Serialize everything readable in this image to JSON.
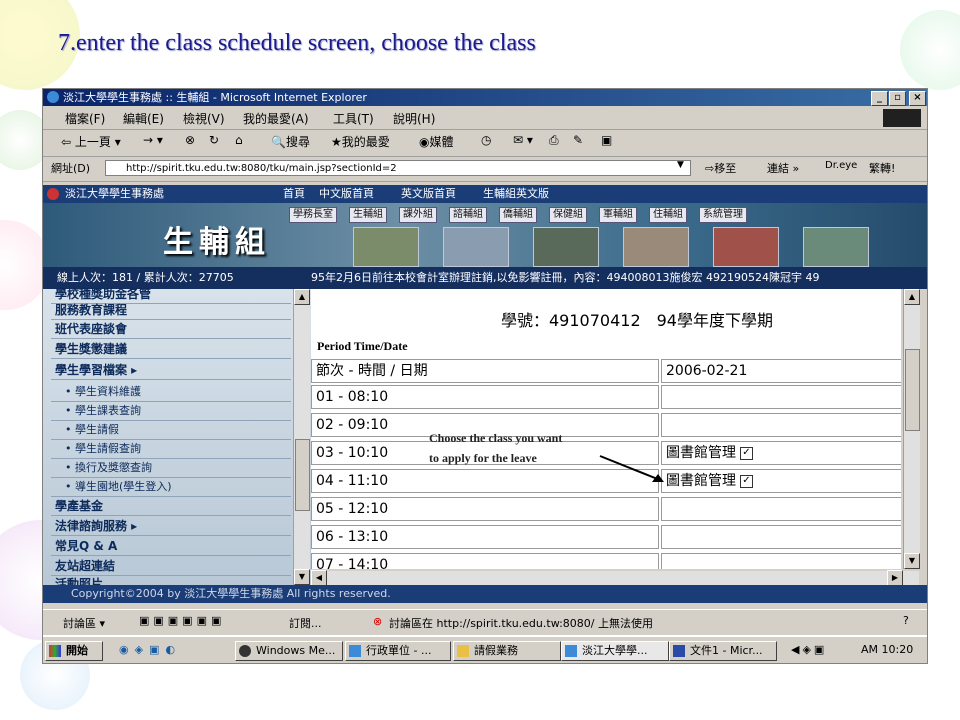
{
  "slide": {
    "title": "7.enter the class schedule screen, choose the class"
  },
  "window": {
    "title": "淡江大學學生事務處 :: 生輔組 - Microsoft Internet Explorer",
    "menu": [
      "檔案(F)",
      "編輯(E)",
      "檢視(V)",
      "我的最愛(A)",
      "工具(T)",
      "說明(H)"
    ],
    "toolbar": {
      "back": "上一頁",
      "search": "搜尋",
      "favorites": "我的最愛",
      "media": "媒體"
    },
    "address": {
      "label": "網址(D)",
      "url": "http://spirit.tku.edu.tw:8080/tku/main.jsp?sectionId=2",
      "go": "移至",
      "links": "連結",
      "dreye": "Dr.eye",
      "convert": "繁轉!"
    }
  },
  "site": {
    "header_title": "淡江大學學生事務處",
    "nav": [
      "首頁",
      "中文版首頁",
      "英文版首頁",
      "生輔組英文版"
    ],
    "logo": "生輔組",
    "tabs": [
      "學務長室",
      "生輔組",
      "課外組",
      "諮輔組",
      "僑輔組",
      "保健組",
      "軍輔組",
      "住輔組",
      "系統管理"
    ],
    "online": "線上人次：181 / 累計人次：27705",
    "marquee": "95年2月6日前往本校會計室辦理註銷,以免影響註冊，內容：494008013施俊宏 492190524陳冠宇 49",
    "sidebar": [
      {
        "label": "學校種獎助金各管",
        "type": "main"
      },
      {
        "label": "服務教育課程",
        "type": "main"
      },
      {
        "label": "班代表座談會",
        "type": "main"
      },
      {
        "label": "學生獎懲建議",
        "type": "main"
      },
      {
        "label": "學生學習檔案 ▸",
        "type": "main"
      },
      {
        "label": "學生資料維護",
        "type": "sub"
      },
      {
        "label": "學生課表查詢",
        "type": "sub"
      },
      {
        "label": "學生請假",
        "type": "sub"
      },
      {
        "label": "學生請假查詢",
        "type": "sub"
      },
      {
        "label": "換行及獎懲查詢",
        "type": "sub"
      },
      {
        "label": "導生園地(學生登入)",
        "type": "sub"
      },
      {
        "label": "學產基金",
        "type": "main"
      },
      {
        "label": "法律諮詢服務 ▸",
        "type": "main"
      },
      {
        "label": "常見Q & A",
        "type": "main"
      },
      {
        "label": "友站超連結",
        "type": "main"
      },
      {
        "label": "活動照片",
        "type": "main"
      }
    ],
    "copyright": "Copyright©2004 by 淡江大學學生事務處 All rights reserved."
  },
  "schedule": {
    "heading": "學號：491070412　94學年度下學期",
    "period_label": "Period Time/Date",
    "col1_header": "節次 - 時間 / 日期",
    "col2_header": "2006-02-21",
    "rows": [
      {
        "period": "01 - 08:10",
        "course": ""
      },
      {
        "period": "02 - 09:10",
        "course": ""
      },
      {
        "period": "03 - 10:10",
        "course": "圖書館管理",
        "checked": true
      },
      {
        "period": "04 - 11:10",
        "course": "圖書館管理",
        "checked": true
      },
      {
        "period": "05 - 12:10",
        "course": ""
      },
      {
        "period": "06 - 13:10",
        "course": ""
      },
      {
        "period": "07 - 14:10",
        "course": ""
      }
    ],
    "check_mark": "✓"
  },
  "callout": {
    "line1": "Choose the class you want",
    "line2": "to apply for the leave"
  },
  "statusbar": {
    "discuss": "討論區",
    "subscribe": "訂閱...",
    "message": "討論區在 http://spirit.tku.edu.tw:8080/ 上無法使用"
  },
  "taskbar": {
    "start": "開始",
    "tasks": [
      "Windows Me...",
      "行政單位 - ...",
      "請假業務",
      "淡江大學學...",
      "文件1 - Micr..."
    ],
    "clock": "AM 10:20"
  },
  "colors": {
    "title": "#1b1b8a",
    "site_blue": "#1a3d78",
    "win_gray": "#d4d0c8"
  }
}
